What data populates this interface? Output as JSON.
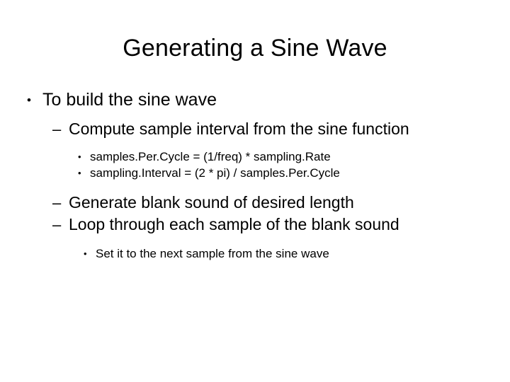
{
  "slide": {
    "title": "Generating a Sine Wave",
    "background_color": "#ffffff",
    "text_color": "#000000",
    "markers": {
      "level1": "•",
      "level2": "–",
      "level3": "•"
    },
    "outline": [
      {
        "level": 1,
        "marker": "•",
        "text": "To build the sine wave"
      },
      {
        "level": 2,
        "marker": "–",
        "text": "Compute sample interval from the sine function"
      },
      {
        "level": 3,
        "marker": "•",
        "text": "samples.Per.Cycle = (1/freq) * sampling.Rate"
      },
      {
        "level": 3,
        "marker": "•",
        "text": "sampling.Interval = (2 * pi) / samples.Per.Cycle"
      },
      {
        "level": 2,
        "marker": "–",
        "text": "Generate blank sound of desired length"
      },
      {
        "level": 2,
        "marker": "–",
        "text": "Loop through each sample of the blank sound"
      },
      {
        "level": 3,
        "marker": "•",
        "text": "Set it to the next sample from the sine wave"
      }
    ]
  }
}
